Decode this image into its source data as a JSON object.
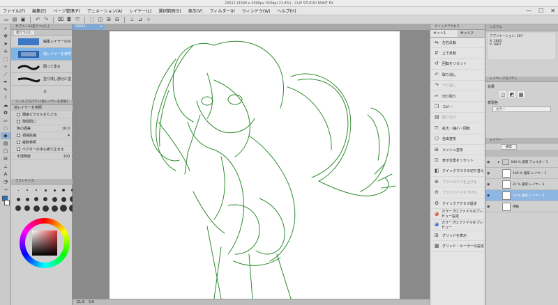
{
  "window": {
    "title": "23012 (3000 x 3000px 350dpi 21.8%) - CLIP STUDIO PAINT EX",
    "min": "—",
    "max": "☐",
    "close": "✕"
  },
  "menu": [
    "ファイル(F)",
    "編集(E)",
    "ページ管理(P)",
    "アニメーション(A)",
    "レイヤー(L)",
    "選択範囲(S)",
    "表示(V)",
    "フィルター(I)",
    "ウィンドウ(W)",
    "ヘルプ(H)"
  ],
  "sub_tool_panel": {
    "title": "サブツール[塗りつぶし]",
    "tabs": [
      "塗りつぶし"
    ],
    "items": [
      {
        "label": "編集レイヤーのみ参照"
      },
      {
        "label": "他レイヤーを参照",
        "selected": true
      },
      {
        "label": "囲って塗る"
      },
      {
        "label": "塗り残し部分に塗る"
      }
    ]
  },
  "tool_property": {
    "title": "ツールプロパティ[他レイヤーを参照]",
    "heading": "他レイヤーを参照",
    "rows": [
      {
        "label": "隣接ピクセルをたどる",
        "value": ""
      },
      {
        "label": "隙間閉じ",
        "value": ""
      },
      {
        "label": "色の誤差",
        "value": "10.0"
      },
      {
        "label": "領域拡縮",
        "value": "4"
      },
      {
        "label": "複数参照",
        "value": ""
      },
      {
        "label": "ベクターの中心線で止まる",
        "value": ""
      },
      {
        "label": "不透明度",
        "value": "100"
      }
    ]
  },
  "brush_size": {
    "title": "ブラシサイズ"
  },
  "canvas": {
    "tab": "23012",
    "status_zoom": "21.8",
    "status_coords": "0.0"
  },
  "quick_access": {
    "tabs": [
      "セット1",
      "セット2"
    ],
    "title": "クイックアクセス",
    "items": [
      {
        "label": "左右反転",
        "icon": "flip-h"
      },
      {
        "label": "上下反転",
        "icon": "flip-v"
      },
      {
        "label": "回転をリセット",
        "icon": "rotate-reset"
      },
      {
        "label": "取り消し",
        "icon": "undo"
      },
      {
        "label": "やり直し",
        "icon": "redo",
        "disabled": true
      },
      {
        "label": "切り取り",
        "icon": "cut"
      },
      {
        "label": "コピー",
        "icon": "copy"
      },
      {
        "label": "貼り付け",
        "icon": "paste",
        "disabled": true
      },
      {
        "label": "拡大・縮小・回転",
        "icon": "transform"
      },
      {
        "label": "自由変形",
        "icon": "free-transform"
      },
      {
        "label": "メッシュ変形",
        "icon": "mesh"
      },
      {
        "label": "表示位置をリセット",
        "icon": "reset-view"
      },
      {
        "label": "クイックマスクの切り替え",
        "icon": "quick-mask"
      },
      {
        "label": "ブラシサイズを上げる",
        "icon": "brush-up",
        "disabled": true
      },
      {
        "label": "ブラシサイズを下げる",
        "icon": "brush-down",
        "disabled": true
      },
      {
        "label": "クイックアクセス設定",
        "icon": "settings"
      },
      {
        "label": "カラープロファイルのプレビュー設定",
        "icon": "color-profile"
      },
      {
        "label": "カラープロファイルをプレビュー",
        "icon": "color-profile-preview"
      },
      {
        "label": "グリッドを表示",
        "icon": "grid"
      },
      {
        "label": "グリッド・ルーラーの設定",
        "icon": "grid-settings"
      }
    ]
  },
  "navigator": {
    "title": "システム",
    "app": "アプリケーション: 297",
    "x": "X: 2805",
    "y": "Y: 1867"
  },
  "layer_property": {
    "title": "レイヤープロパティ",
    "effect": "効果",
    "color_label": "表現色",
    "color_value": "カラー"
  },
  "layers": {
    "title": "レイヤー",
    "blend": "通常",
    "items": [
      {
        "label": "100 % 通常\nフォルダー 1"
      },
      {
        "label": "100 % 通常\nレイヤー 1"
      },
      {
        "label": "21 % 通常\nレイヤー 3"
      },
      {
        "label": "33 % 通常\nレイヤー 2",
        "selected": true
      },
      {
        "label": "用紙"
      }
    ]
  }
}
